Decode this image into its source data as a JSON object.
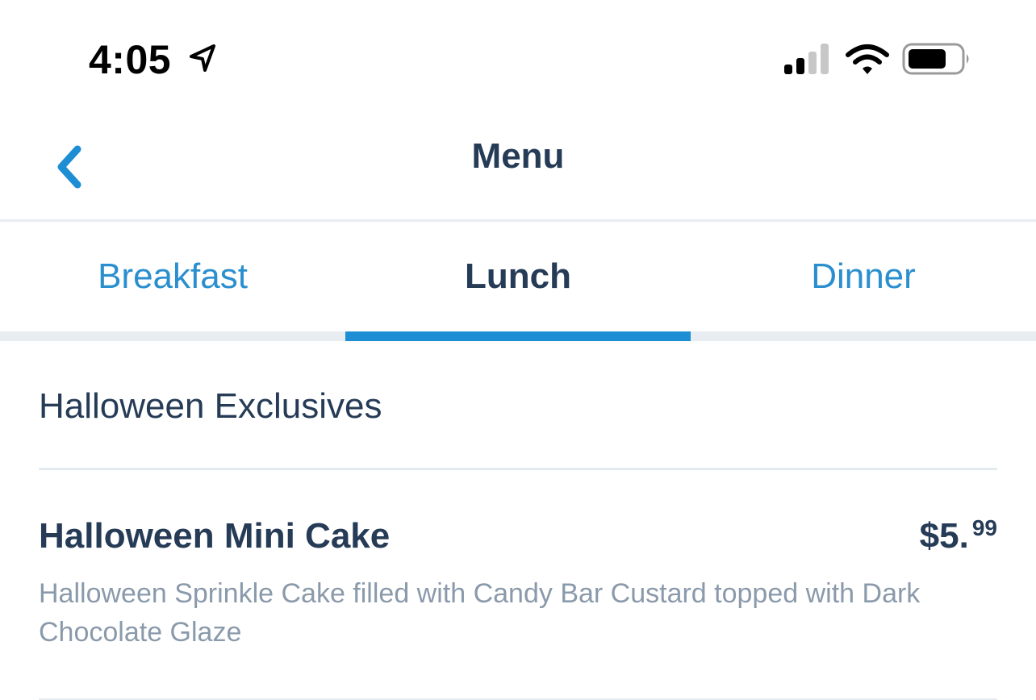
{
  "status_bar": {
    "time": "4:05",
    "icons": [
      "location-arrow-icon",
      "cellular-signal-icon",
      "wifi-icon",
      "battery-icon"
    ]
  },
  "nav": {
    "title": "Menu",
    "back_icon": "chevron-left-icon"
  },
  "tabs": [
    {
      "label": "Breakfast",
      "active": false
    },
    {
      "label": "Lunch",
      "active": true
    },
    {
      "label": "Dinner",
      "active": false
    }
  ],
  "section": {
    "title": "Halloween Exclusives",
    "items": [
      {
        "name": "Halloween Mini Cake",
        "price_main": "$5.",
        "price_cents": "99",
        "description": "Halloween Sprinkle Cake filled with Candy Bar Custard topped with Dark Chocolate Glaze"
      }
    ]
  },
  "colors": {
    "accent": "#1e8ed4",
    "tab_inactive": "#2a8fce",
    "text_primary": "#253b56",
    "text_secondary": "#8a9aab"
  }
}
